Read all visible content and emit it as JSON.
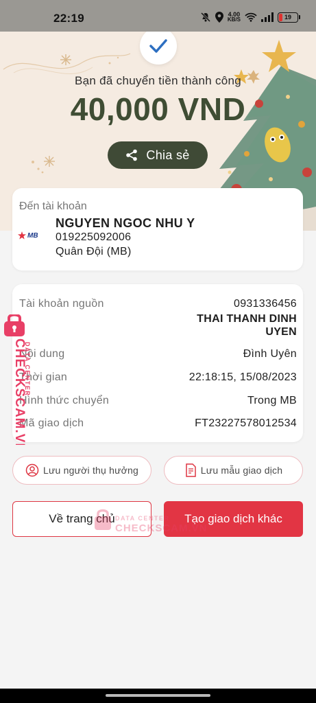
{
  "status_bar": {
    "time": "22:19",
    "speed_value": "4.00",
    "speed_unit": "KB/S",
    "battery": "19",
    "battery_level": 0.19,
    "battery_color": "#e0322f"
  },
  "hero": {
    "icon": "checkmark-icon",
    "success_message": "Bạn đã chuyển tiền thành công",
    "amount": "40,000 VND",
    "share_label": "Chia sẻ",
    "share_icon": "share-icon"
  },
  "recipient": {
    "label": "Đến tài khoản",
    "bank_logo_text": "MB",
    "name": "NGUYEN NGOC NHU Y",
    "account": "019225092006",
    "bank": "Quân Đội (MB)"
  },
  "details": {
    "source_label": "Tài khoản nguồn",
    "source_account": "0931336456",
    "source_name_line1": "THAI THANH DINH",
    "source_name_line2": "UYEN",
    "content_label": "Nội dung",
    "content_value": "Đình Uyên",
    "time_label": "Thời gian",
    "time_value": "22:18:15, 15/08/2023",
    "method_label": "Hình thức chuyển",
    "method_value": "Trong MB",
    "txn_label": "Mã giao dịch",
    "txn_value": "FT23227578012534"
  },
  "actions": {
    "save_beneficiary": "Lưu người thụ hưởng",
    "save_template": "Lưu mẫu giao dịch",
    "home": "Về trang chủ",
    "new_transaction": "Tạo giao dịch khác"
  },
  "watermark": {
    "brand": "CHECKSCAM.VN",
    "sub": "DATA CENTER"
  },
  "colors": {
    "accent_red": "#e23544",
    "dark_green": "#3f4a36",
    "hero_bg": "#f5ebe1"
  }
}
